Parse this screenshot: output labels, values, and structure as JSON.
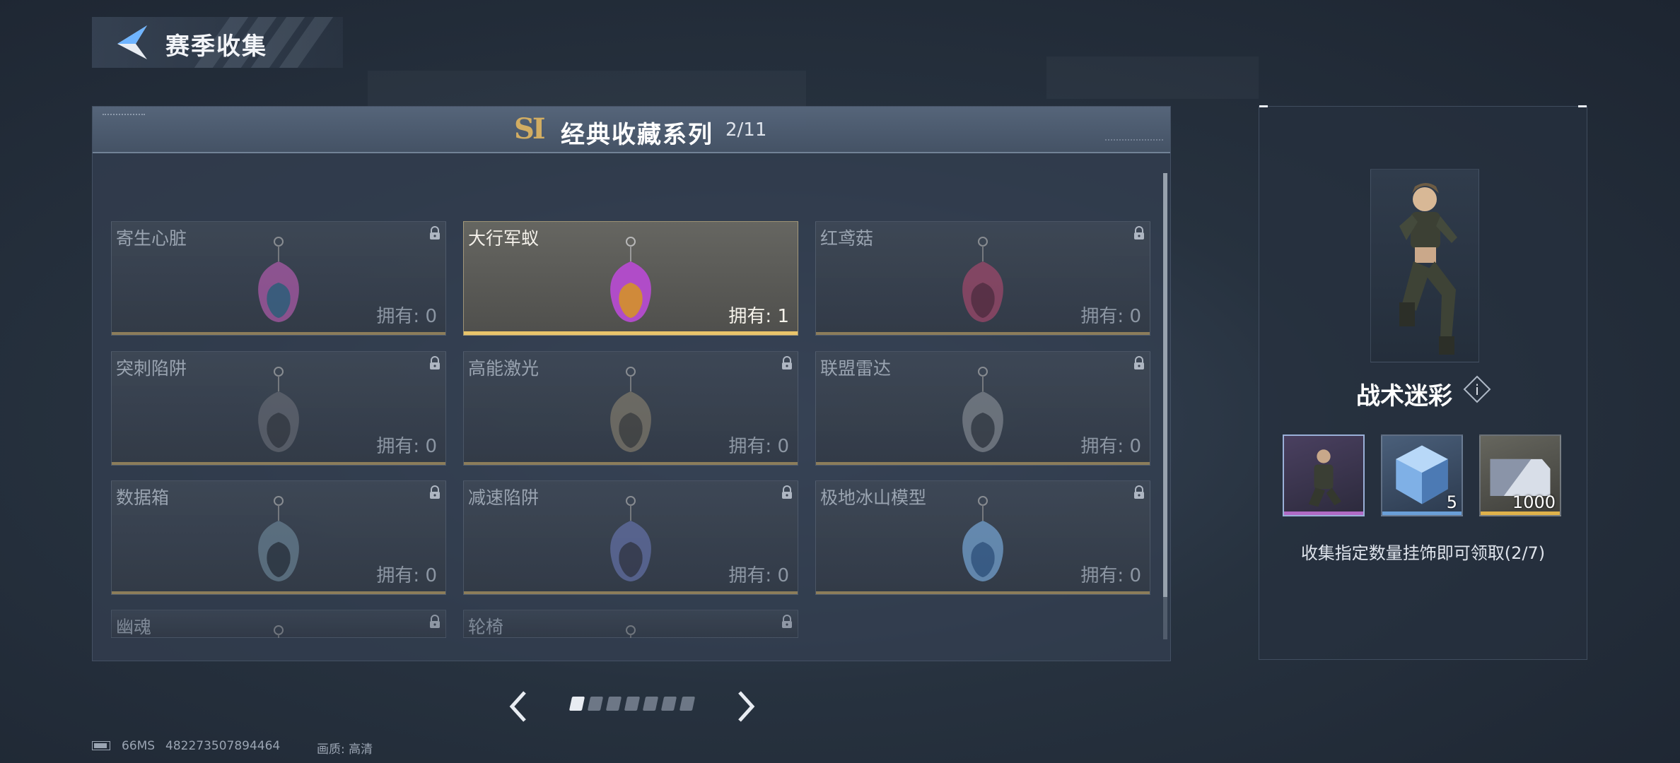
{
  "header": {
    "title": "赛季收集"
  },
  "series": {
    "badge": "SI",
    "title": "经典收藏系列",
    "progress": "2/11"
  },
  "items": [
    {
      "name": "寄生心脏",
      "count": "拥有: 0",
      "locked": true,
      "icon": "parasite-heart-charm"
    },
    {
      "name": "大行军蚁",
      "count": "拥有: 1",
      "locked": false,
      "icon": "army-ant-charm"
    },
    {
      "name": "红鸢菇",
      "count": "拥有: 0",
      "locked": true,
      "icon": "red-mushroom-charm"
    },
    {
      "name": "突刺陷阱",
      "count": "拥有: 0",
      "locked": true,
      "icon": "spike-trap-charm"
    },
    {
      "name": "高能激光",
      "count": "拥有: 0",
      "locked": true,
      "icon": "laser-charm"
    },
    {
      "name": "联盟雷达",
      "count": "拥有: 0",
      "locked": true,
      "icon": "radar-charm"
    },
    {
      "name": "数据箱",
      "count": "拥有: 0",
      "locked": true,
      "icon": "data-box-charm"
    },
    {
      "name": "减速陷阱",
      "count": "拥有: 0",
      "locked": true,
      "icon": "slow-trap-charm"
    },
    {
      "name": "极地冰山模型",
      "count": "拥有: 0",
      "locked": true,
      "icon": "iceberg-charm"
    },
    {
      "name": "幽魂",
      "count": "",
      "locked": true,
      "icon": "ghost-charm"
    },
    {
      "name": "轮椅",
      "count": "",
      "locked": true,
      "icon": "wheelchair-charm"
    }
  ],
  "pagination": {
    "total": 7,
    "current": 1
  },
  "reward": {
    "name": "战术迷彩",
    "items": [
      {
        "qty": "",
        "rarity_color": "#b06ac4",
        "icon": "skin-portrait"
      },
      {
        "qty": "5",
        "rarity_color": "#6a9fd8",
        "icon": "crystal-cube"
      },
      {
        "qty": "1000",
        "rarity_color": "#e0b24a",
        "icon": "ticket-card"
      }
    ],
    "note": "收集指定数量挂饰即可领取(2/7)"
  },
  "status": {
    "ping": "66MS",
    "uid": "482273507894464",
    "quality": "画质: 高清"
  },
  "colors": {
    "accent_gold": "#e9c46a",
    "bar_muted": "#8c7d5a"
  }
}
